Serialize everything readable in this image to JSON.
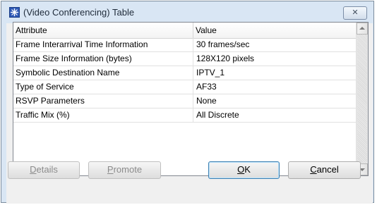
{
  "window": {
    "title": "(Video Conferencing) Table",
    "close_icon": "close-icon"
  },
  "table": {
    "columns": [
      "Attribute",
      "Value"
    ],
    "rows": [
      {
        "attribute": "Frame Interarrival Time Information",
        "value": "30 frames/sec"
      },
      {
        "attribute": "Frame Size Information (bytes)",
        "value": "128X120 pixels"
      },
      {
        "attribute": "Symbolic Destination Name",
        "value": "IPTV_1"
      },
      {
        "attribute": "Type of Service",
        "value": "AF33"
      },
      {
        "attribute": "RSVP Parameters",
        "value": "None"
      },
      {
        "attribute": "Traffic Mix (%)",
        "value": "All Discrete"
      }
    ]
  },
  "buttons": {
    "details": {
      "mnemonic": "D",
      "rest": "etails"
    },
    "promote": {
      "mnemonic": "P",
      "rest": "romote"
    },
    "ok": {
      "mnemonic": "O",
      "rest": "K"
    },
    "cancel": {
      "mnemonic": "C",
      "rest": "ancel"
    }
  }
}
